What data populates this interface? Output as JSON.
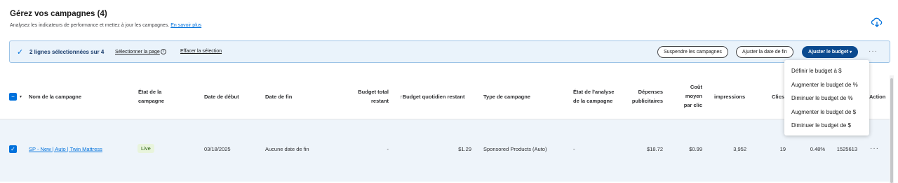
{
  "header": {
    "title": "Gérez vos campagnes (4)",
    "subtitle": "Analysez les indicateurs de performance et mettez à jour les campagnes.",
    "learn_more": "En savoir plus"
  },
  "icons": {
    "download": "cloud-download-icon",
    "check": "check-icon",
    "info": "info-icon",
    "more": "more-horizontal-icon"
  },
  "colors": {
    "accent": "#0071dc",
    "primary_button": "#0b4a8f",
    "live_badge_bg": "#e8f4dc",
    "live_badge_text": "#2a6310",
    "selection_bg": "#eaf3fb"
  },
  "selection_bar": {
    "count_text": "2 lignes sélectionnées sur 4",
    "select_page": "Sélectionner la page",
    "clear_selection": "Effacer la sélection",
    "suspend_button": "Suspendre les campagnes",
    "end_date_button": "Ajuster la date de fin",
    "budget_button": "Ajuster le budget",
    "more": "···"
  },
  "table": {
    "columns": {
      "name": "Nom de la campagne",
      "state_line1": "État de la",
      "state_line2": "campagne",
      "start": "Date de début",
      "end": "Date de fin",
      "budget_total_line1": "Budget total",
      "budget_total_line2": "restant",
      "budget_daily": "↑Budget quotidien restant",
      "type": "Type de campagne",
      "analysis_line1": "État de l'analyse",
      "analysis_line2": "de la campagne",
      "spend_line1": "Dépenses",
      "spend_line2": "publicitaires",
      "cpc_line1": "Coût",
      "cpc_line2": "moyen",
      "cpc_line3": "par clic",
      "impressions": "impressions",
      "clicks": "Clics",
      "action": "Action"
    },
    "row": {
      "name": "SP - New | Auto | Twin Mattress",
      "state": "Live",
      "start": "03/18/2025",
      "end": "Aucune date de fin",
      "budget_total": "-",
      "budget_daily": "$1.29",
      "type": "Sponsored Products (Auto)",
      "analysis": "-",
      "spend": "$18.72",
      "cpc": "$0.99",
      "impressions": "3,952",
      "clicks": "19",
      "ctr": "0.48%",
      "id": "1525613",
      "more": "···"
    }
  },
  "budget_menu": [
    "Définir le budget à $",
    "Augmenter le budget de %",
    "Diminuer le budget de %",
    "Augmenter le budget de $",
    "Diminuer le budget de $"
  ]
}
